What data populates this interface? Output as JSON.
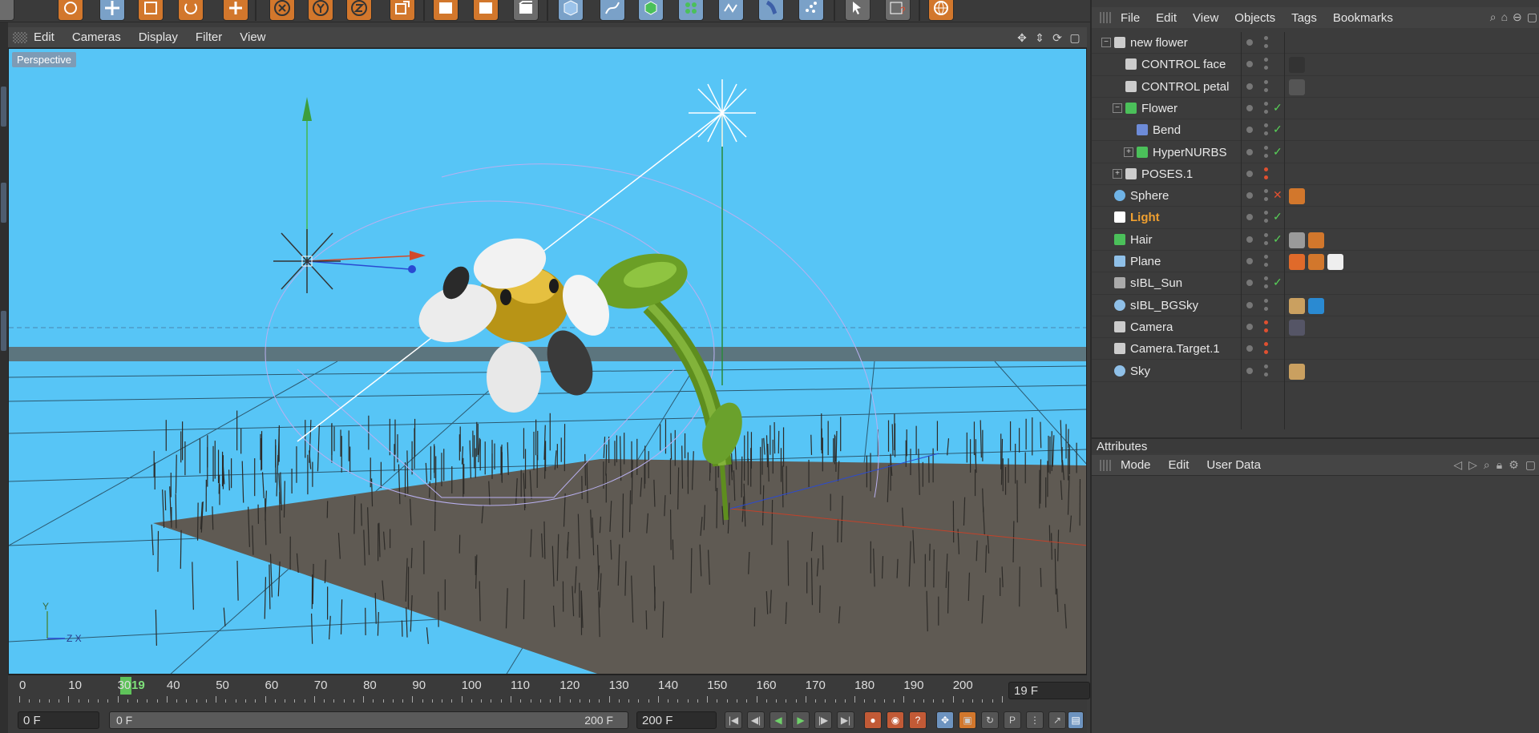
{
  "toolbar": {
    "icons": [
      "live-selection-icon",
      "move-icon",
      "scale-icon",
      "rotate-icon",
      "add-icon",
      "x-axis-icon",
      "y-axis-icon",
      "z-axis-icon",
      "coordinate-system-icon",
      "render-view-icon",
      "render-icon",
      "render-settings-icon",
      "cube-icon",
      "spline-pen-icon",
      "nurbs-icon",
      "array-icon",
      "deformer-icon",
      "bend-icon",
      "particles-icon",
      "selection-icon",
      "help-icon",
      "sphere-icon"
    ]
  },
  "viewport_menu": {
    "items": [
      "Edit",
      "Cameras",
      "Display",
      "Filter",
      "View"
    ],
    "label": "Perspective",
    "axis_y": "Y",
    "axis_zx": "Z X"
  },
  "timeline": {
    "ticks": [
      "0",
      "10",
      "19",
      "30",
      "40",
      "50",
      "60",
      "70",
      "80",
      "90",
      "100",
      "110",
      "120",
      "130",
      "140",
      "150",
      "160",
      "170",
      "180",
      "190",
      "200"
    ],
    "current_frame": "19 F"
  },
  "transport": {
    "start_field": "0 F",
    "slider_start": "0 F",
    "slider_end": "200 F",
    "end_field": "200 F"
  },
  "object_manager": {
    "menu": [
      "File",
      "Edit",
      "View",
      "Objects",
      "Tags",
      "Bookmarks"
    ],
    "rows": [
      {
        "name": "new flower",
        "indent": 0,
        "tree": "−",
        "icon": "null-icon"
      },
      {
        "name": "CONTROL face",
        "indent": 1,
        "tree": "",
        "icon": "null-icon"
      },
      {
        "name": "CONTROL petal",
        "indent": 1,
        "tree": "",
        "icon": "null-icon"
      },
      {
        "name": "Flower",
        "indent": 1,
        "tree": "−",
        "icon": "hypernurbs-icon"
      },
      {
        "name": "Bend",
        "indent": 2,
        "tree": "",
        "icon": "bend-icon"
      },
      {
        "name": "HyperNURBS",
        "indent": 2,
        "tree": "+",
        "icon": "hypernurbs-icon"
      },
      {
        "name": "POSES.1",
        "indent": 1,
        "tree": "+",
        "icon": "null-icon"
      },
      {
        "name": "Sphere",
        "indent": 0,
        "tree": "",
        "icon": "sphere-icon"
      },
      {
        "name": "Light",
        "indent": 0,
        "tree": "",
        "icon": "light-icon"
      },
      {
        "name": "Hair",
        "indent": 0,
        "tree": "",
        "icon": "hair-icon"
      },
      {
        "name": "Plane",
        "indent": 0,
        "tree": "",
        "icon": "plane-icon"
      },
      {
        "name": "sIBL_Sun",
        "indent": 0,
        "tree": "",
        "icon": "sun-icon"
      },
      {
        "name": "sIBL_BGSky",
        "indent": 0,
        "tree": "",
        "icon": "sky-icon"
      },
      {
        "name": "Camera",
        "indent": 0,
        "tree": "",
        "icon": "camera-icon"
      },
      {
        "name": "Camera.Target.1",
        "indent": 0,
        "tree": "",
        "icon": "null-icon"
      },
      {
        "name": "Sky",
        "indent": 0,
        "tree": "",
        "icon": "sky-icon"
      }
    ],
    "active_row": "Light"
  },
  "attributes": {
    "title": "Attributes",
    "menu": [
      "Mode",
      "Edit",
      "User Data"
    ]
  },
  "colors": {
    "viewport_bg": "#57c5f6",
    "accent_orange": "#d2772c",
    "active_name": "#f0a030"
  }
}
